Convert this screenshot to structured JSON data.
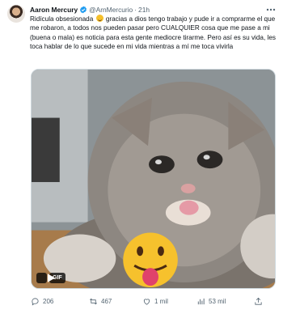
{
  "tweet": {
    "author_name": "Aaron Mercury",
    "handle": "@ArnMercurio",
    "separator": "·",
    "time": "21h",
    "text_before_emoji": "Ridícula obsesionada",
    "text_after_emoji": " gracias a dios tengo trabajo y pude ir a comprarme el que me robaron, a todos nos pueden pasar pero CUALQUIER cosa que me pase a mi (buena o mala) es noticia para esta gente mediocre tirarme. Pero así es su vida, les toca hablar de lo que sucede en mi vida mientras a mí me toca vivirla",
    "media": {
      "type": "GIF",
      "badge": "GIF"
    },
    "actions": {
      "replies": "206",
      "reposts": "467",
      "likes": "1 mil",
      "views": "53 mil"
    }
  },
  "icons": {
    "verified": "verified-badge-icon",
    "more": "more-icon",
    "reply": "reply-icon",
    "repost": "repost-icon",
    "like": "heart-icon",
    "views": "views-icon",
    "share": "share-icon",
    "play": "play-icon"
  },
  "colors": {
    "text": "#0f1419",
    "secondary": "#536471",
    "verified": "#1d9bf0"
  }
}
